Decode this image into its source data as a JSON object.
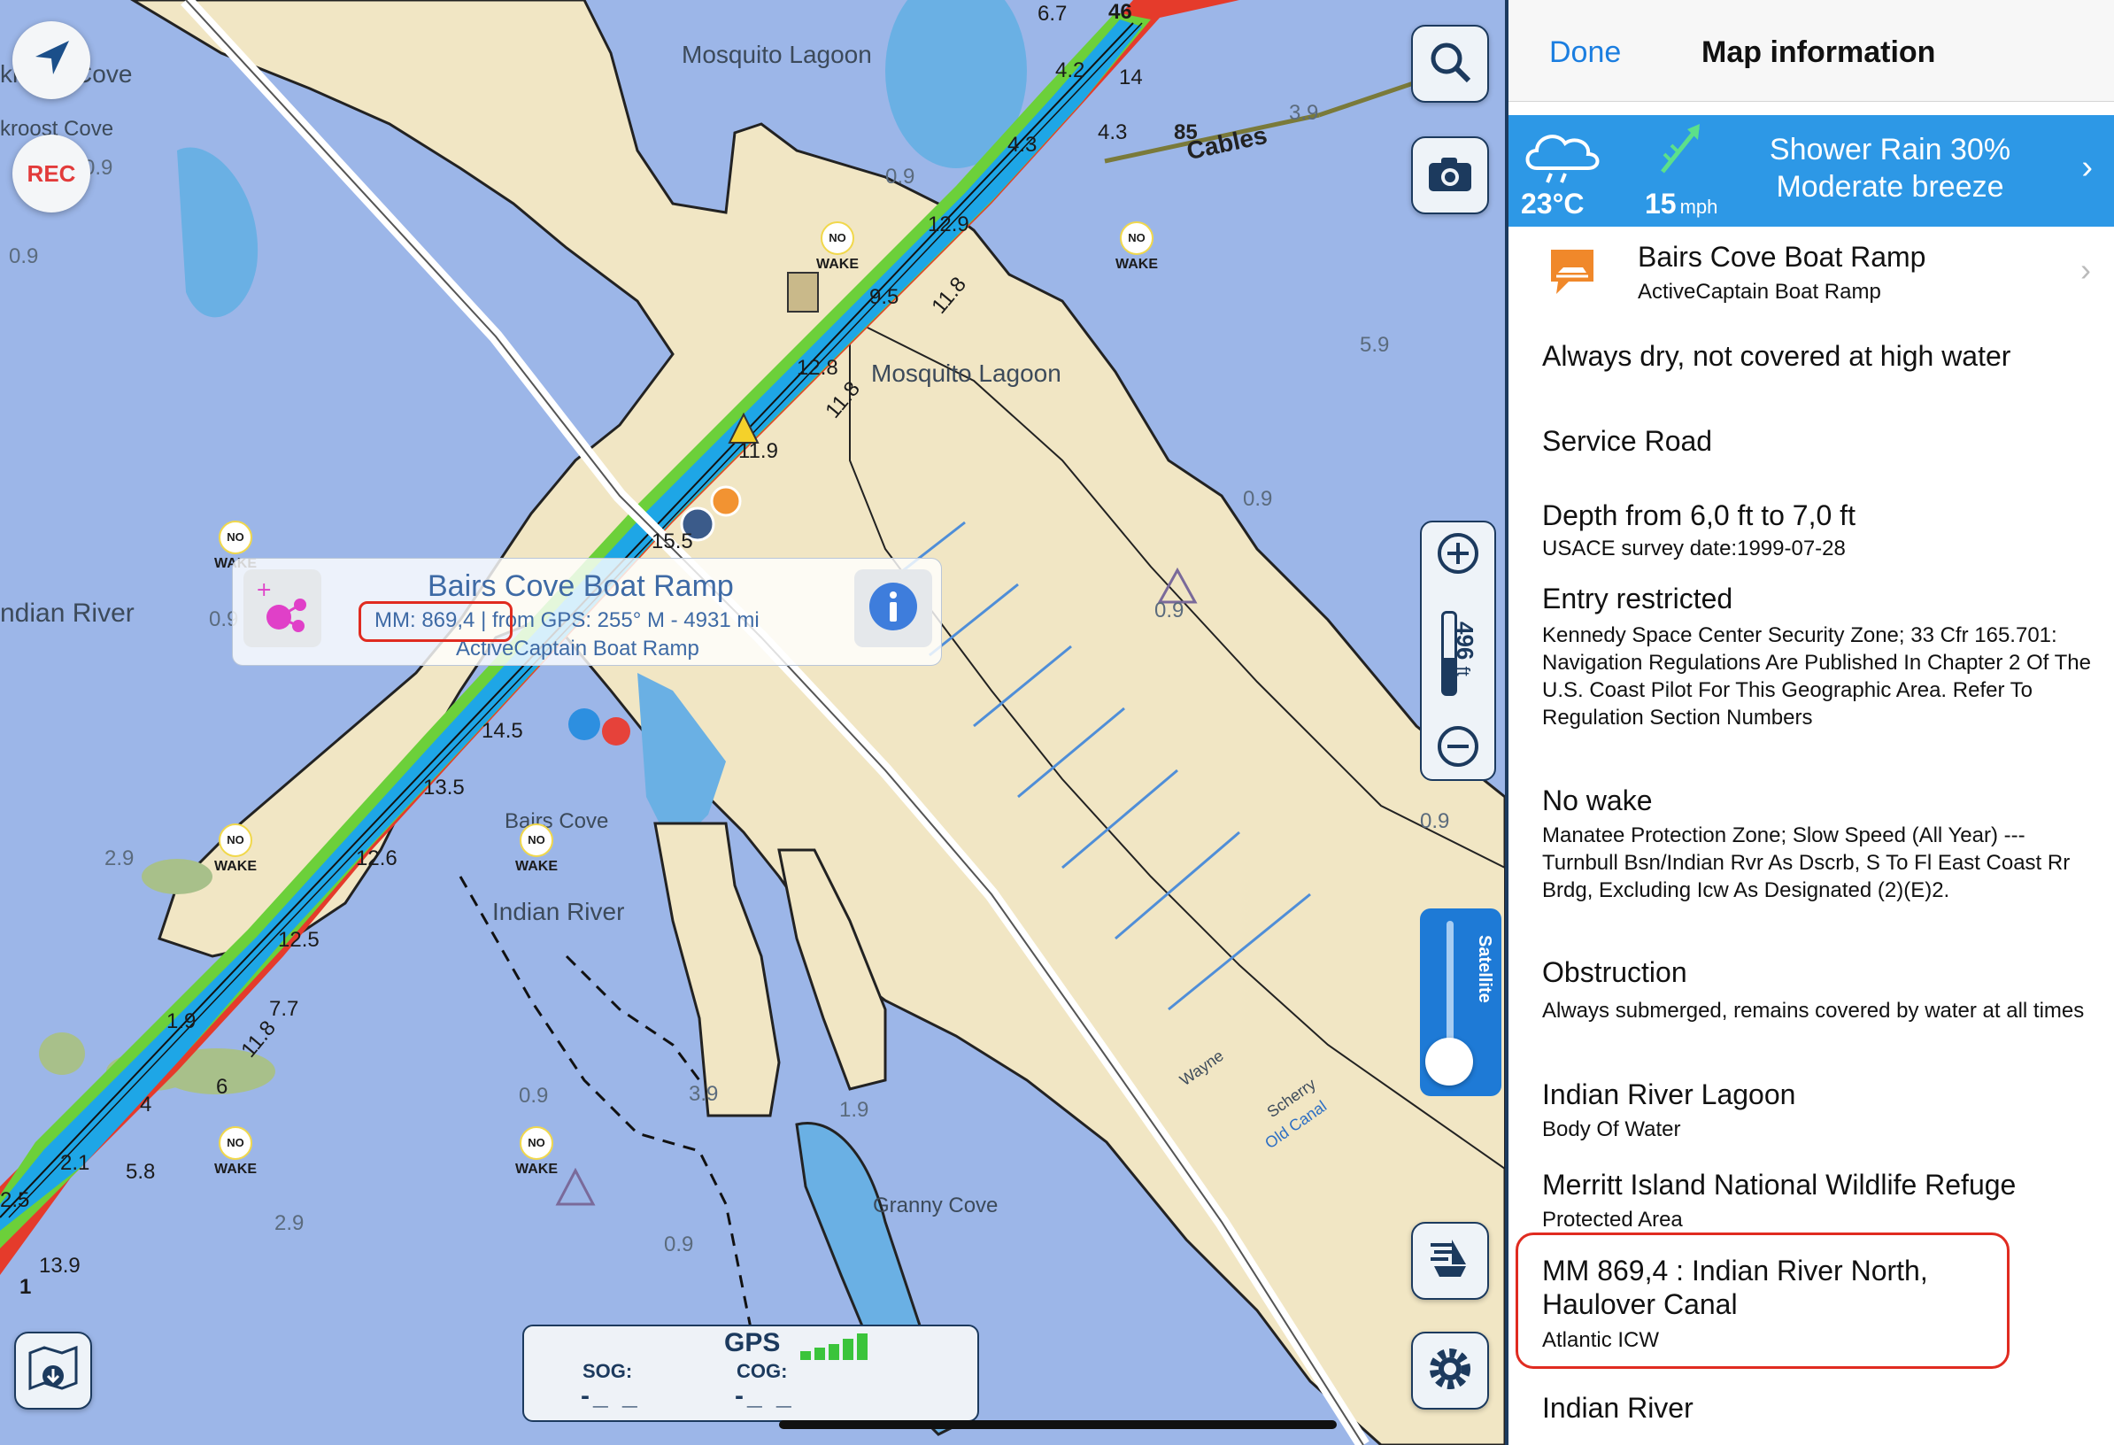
{
  "map": {
    "places": {
      "mosquito_lagoon_top": "Mosquito Lagoon",
      "mosquito_lagoon_mid": "Mosquito Lagoon",
      "indian_river_left": "ndian River",
      "indian_river_center": "Indian River",
      "bairs_cove": "Bairs Cove",
      "granny_cove": "Granny Cove",
      "cove_top": "kroost Cove",
      "cove_top2": "kroost Cove",
      "cables": "Cables",
      "cables_num": "85",
      "wayne": "Wayne",
      "scherry": "Scherry",
      "old_canal": "Old Canal"
    },
    "depths": [
      "0.9",
      "6.7",
      "46",
      "4.2",
      "14",
      "4.3",
      "4.3",
      "3.9",
      "12.9",
      "9.5",
      "11.8",
      "12.8",
      "11.8",
      "11.9",
      "0.9",
      "15.5",
      "14.5",
      "13.5",
      "12.6",
      "12.5",
      "7.7",
      "11.8",
      "1.9",
      "6",
      "4",
      "2.1",
      "5.8",
      "2.5",
      "1",
      "13.9",
      "0.9",
      "2.9",
      "0.9",
      "3.9",
      "0.9",
      "1.9",
      "2.9",
      "0.9",
      "5.9",
      "0.9",
      "0.9",
      "0.9"
    ],
    "no_wake_label": "WAKE",
    "no_wake_top": "NO",
    "rec_label": "REC"
  },
  "popup": {
    "title": "Bairs Cove Boat Ramp",
    "mm": "MM: 869,4",
    "separator": "|",
    "from_gps": "from GPS: 255° M - 4931 mi",
    "type": "ActiveCaptain Boat Ramp"
  },
  "zoom": {
    "scale": "496",
    "unit": "ft"
  },
  "satellite": {
    "label": "Satellite"
  },
  "gps": {
    "title": "GPS",
    "sog_label": "SOG:",
    "cog_label": "COG:",
    "sog_value": "-_ _",
    "cog_value": "-_ _"
  },
  "panel": {
    "done_label": "Done",
    "title": "Map information",
    "weather": {
      "temp": "23°C",
      "wind_speed": "15",
      "wind_unit": "mph",
      "line1": "Shower Rain 30%",
      "line2": "Moderate breeze"
    },
    "rows": [
      {
        "title": "Bairs Cove Boat Ramp",
        "sub": "ActiveCaptain Boat Ramp"
      },
      {
        "title": "Always dry, not covered at high water"
      },
      {
        "title": "Service Road"
      },
      {
        "title": "Depth from 6,0 ft to 7,0 ft",
        "sub": "USACE survey date:1999-07-28"
      },
      {
        "title": "Entry restricted",
        "sub": "Kennedy Space Center Security Zone; 33 Cfr 165.701: Navigation Regulations Are Published In Chapter 2 Of The U.S. Coast Pilot For This Geographic Area. Refer To Regulation Section Numbers"
      },
      {
        "title": "No wake",
        "sub": "Manatee Protection Zone; Slow Speed (All Year) --- Turnbull Bsn/Indian Rvr As Dscrb, S To Fl East Coast Rr Brdg, Excluding Icw As Designated (2)(E)2."
      },
      {
        "title": "Obstruction",
        "sub": "Always submerged, remains covered by water at all times"
      },
      {
        "title": "Indian River Lagoon",
        "sub": "Body Of Water"
      },
      {
        "title": "Merritt Island National Wildlife Refuge",
        "sub": "Protected Area"
      },
      {
        "title": "MM 869,4 : Indian River North, Haulover Canal",
        "sub": "Atlantic ICW"
      },
      {
        "title": "Indian River"
      }
    ]
  }
}
